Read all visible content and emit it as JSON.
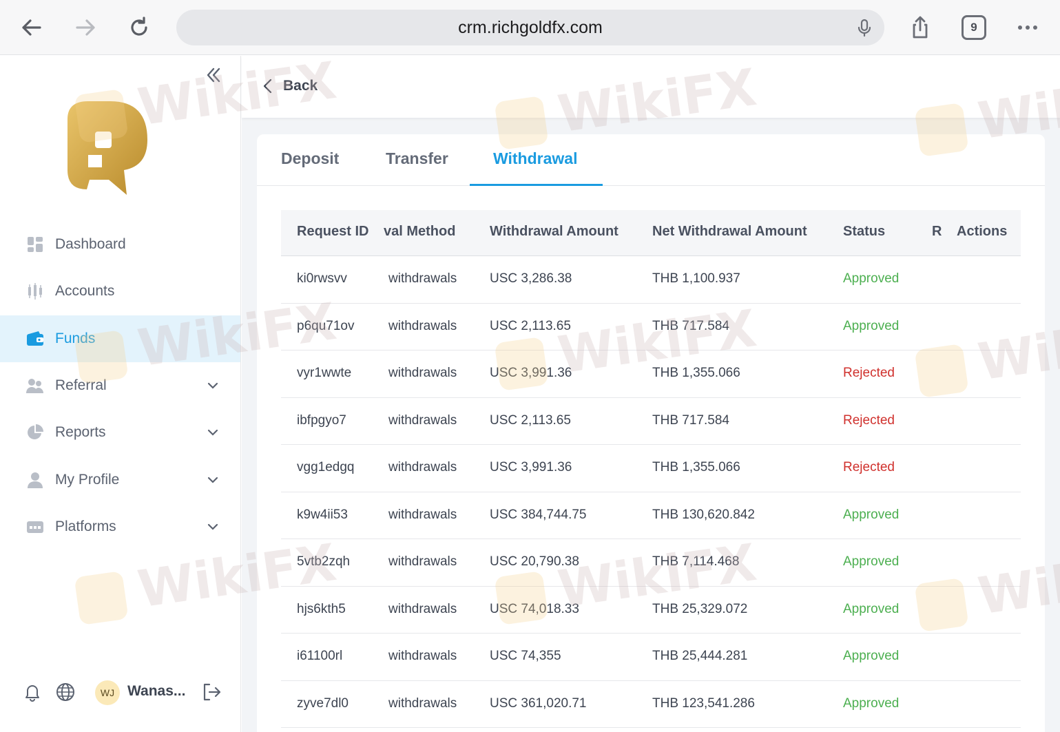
{
  "browser": {
    "url": "crm.richgoldfx.com",
    "tab_count": "9"
  },
  "sidebar": {
    "items": [
      {
        "label": "Dashboard",
        "icon": "dashboard-icon"
      },
      {
        "label": "Accounts",
        "icon": "accounts-icon"
      },
      {
        "label": "Funds",
        "icon": "wallet-icon",
        "active": true
      },
      {
        "label": "Referral",
        "icon": "referral-icon"
      },
      {
        "label": "Reports",
        "icon": "pie-chart-icon"
      },
      {
        "label": "My Profile",
        "icon": "user-icon"
      },
      {
        "label": "Platforms",
        "icon": "platforms-icon"
      }
    ],
    "user": {
      "initials": "WJ",
      "name": "Wanas..."
    }
  },
  "main": {
    "back_label": "Back",
    "tabs": [
      {
        "label": "Deposit"
      },
      {
        "label": "Transfer"
      },
      {
        "label": "Withdrawal",
        "active": true
      }
    ],
    "table": {
      "headers": [
        "Request ID",
        "val Method",
        "Withdrawal Amount",
        "Net Withdrawal Amount",
        "Status",
        "R",
        "Actions"
      ],
      "rows": [
        {
          "id": "ki0rwsvv",
          "method": "withdrawals",
          "amount": "USC 3,286.38",
          "net": "THB 1,100.937",
          "status": "Approved"
        },
        {
          "id": "p6qu71ov",
          "method": "withdrawals",
          "amount": "USC 2,113.65",
          "net": "THB 717.584",
          "status": "Approved"
        },
        {
          "id": "vyr1wwte",
          "method": "withdrawals",
          "amount": "USC 3,991.36",
          "net": "THB 1,355.066",
          "status": "Rejected"
        },
        {
          "id": "ibfpgyo7",
          "method": "withdrawals",
          "amount": "USC 2,113.65",
          "net": "THB 717.584",
          "status": "Rejected"
        },
        {
          "id": "vgg1edgq",
          "method": "withdrawals",
          "amount": "USC 3,991.36",
          "net": "THB 1,355.066",
          "status": "Rejected"
        },
        {
          "id": "k9w4ii53",
          "method": "withdrawals",
          "amount": "USC 384,744.75",
          "net": "THB 130,620.842",
          "status": "Approved"
        },
        {
          "id": "5vtb2zqh",
          "method": "withdrawals",
          "amount": "USC 20,790.38",
          "net": "THB 7,114.468",
          "status": "Approved"
        },
        {
          "id": "hjs6kth5",
          "method": "withdrawals",
          "amount": "USC 74,018.33",
          "net": "THB 25,329.072",
          "status": "Approved"
        },
        {
          "id": "i61100rl",
          "method": "withdrawals",
          "amount": "USC 74,355",
          "net": "THB 25,444.281",
          "status": "Approved"
        },
        {
          "id": "zyve7dl0",
          "method": "withdrawals",
          "amount": "USC 361,020.71",
          "net": "THB 123,541.286",
          "status": "Approved"
        }
      ]
    }
  },
  "watermark": "WikiFX",
  "colors": {
    "accent": "#1a9be0",
    "approved": "#4caf50",
    "rejected": "#d0312d",
    "logo_gold": "#d9b04a"
  }
}
